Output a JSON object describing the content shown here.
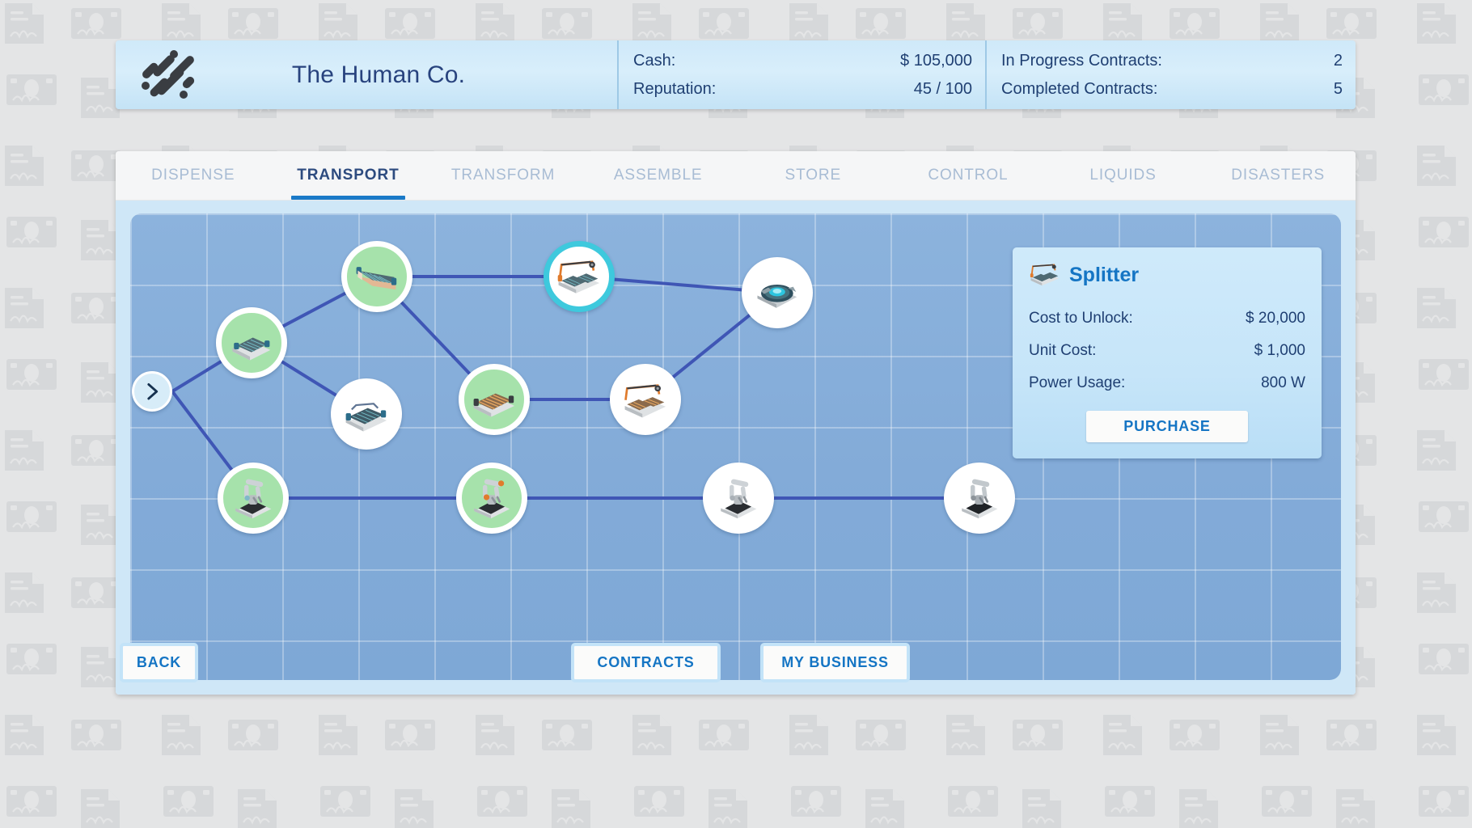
{
  "header": {
    "logo_icon": "diagonal-dashes-logo",
    "company_name": "The Human Co.",
    "stats_left": [
      {
        "label": "Cash:",
        "value": "$ 105,000"
      },
      {
        "label": "Reputation:",
        "value": "45 / 100"
      }
    ],
    "stats_right": [
      {
        "label": "In Progress Contracts:",
        "value": "2"
      },
      {
        "label": "Completed Contracts:",
        "value": "5"
      }
    ]
  },
  "tabs": [
    {
      "label": "DISPENSE",
      "active": false
    },
    {
      "label": "TRANSPORT",
      "active": true
    },
    {
      "label": "TRANSFORM",
      "active": false
    },
    {
      "label": "ASSEMBLE",
      "active": false
    },
    {
      "label": "STORE",
      "active": false
    },
    {
      "label": "CONTROL",
      "active": false
    },
    {
      "label": "LIQUIDS",
      "active": false
    },
    {
      "label": "DISASTERS",
      "active": false
    }
  ],
  "tree": {
    "root": {
      "icon": "chevron-right-icon"
    },
    "nodes": [
      {
        "id": "n1",
        "icon": "conveyor-belt-icon",
        "state": "unlocked"
      },
      {
        "id": "n2",
        "icon": "conveyor-incline-icon",
        "state": "unlocked"
      },
      {
        "id": "n3",
        "icon": "splitter-icon",
        "state": "selected"
      },
      {
        "id": "n4",
        "icon": "turntable-icon",
        "state": "locked"
      },
      {
        "id": "n5",
        "icon": "conveyor-wide-icon",
        "state": "locked"
      },
      {
        "id": "n6",
        "icon": "roller-conveyor-icon",
        "state": "unlocked"
      },
      {
        "id": "n7",
        "icon": "merger-icon",
        "state": "locked"
      },
      {
        "id": "n8",
        "icon": "robot-arm-icon",
        "state": "unlocked"
      },
      {
        "id": "n9",
        "icon": "robot-arm-orange-icon",
        "state": "unlocked"
      },
      {
        "id": "n10",
        "icon": "robot-arm-grey-icon",
        "state": "locked"
      },
      {
        "id": "n11",
        "icon": "robot-arm-dark-icon",
        "state": "locked"
      }
    ]
  },
  "info_panel": {
    "icon": "splitter-icon",
    "title": "Splitter",
    "rows": [
      {
        "label": "Cost to Unlock:",
        "value": "$ 20,000"
      },
      {
        "label": "Unit Cost:",
        "value": "$ 1,000"
      },
      {
        "label": "Power Usage:",
        "value": "800 W"
      }
    ],
    "purchase_label": "PURCHASE"
  },
  "footer": {
    "back_label": "BACK",
    "contracts_label": "CONTRACTS",
    "my_business_label": "MY BUSINESS"
  },
  "colors": {
    "accent_blue": "#1575c4",
    "header_text": "#1f3f72",
    "tab_active": "#2d4b7f",
    "tab_inactive": "#a8bcd4",
    "unlocked_node": "#a6e2ab",
    "selected_ring": "#3ec9dd",
    "edge_line": "#3f56b5",
    "board_bg": "#83abd8",
    "page_bg": "#e4e5e6"
  }
}
